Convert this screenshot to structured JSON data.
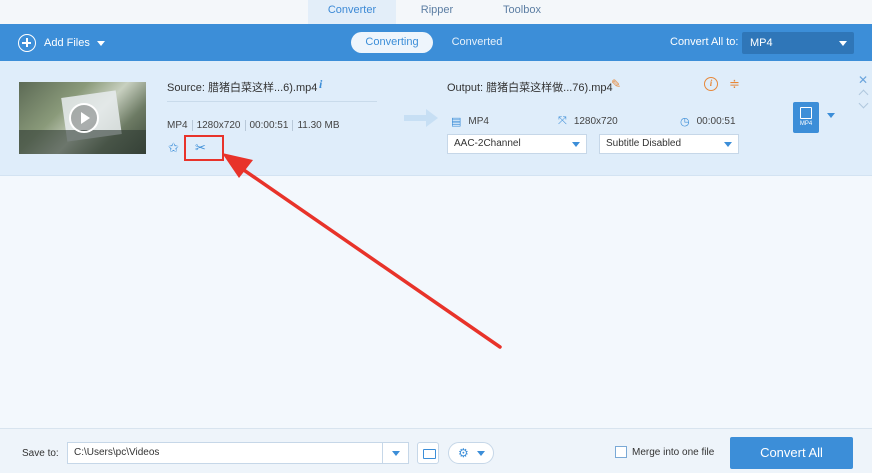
{
  "tabs": {
    "converter": "Converter",
    "ripper": "Ripper",
    "toolbox": "Toolbox",
    "active": "converter"
  },
  "toolbar": {
    "add_files": "Add Files",
    "converting": "Converting",
    "converted": "Converted",
    "convert_all_to": "Convert All to:",
    "format": "MP4"
  },
  "file": {
    "source_name": "Source: 腊猪白菜这样...6).mp4",
    "format": "MP4",
    "resolution": "1280x720",
    "duration": "00:00:51",
    "size": "11.30 MB",
    "output_name": "Output: 腊猪白菜这样做...76).mp4",
    "output_format": "MP4",
    "output_resolution": "1280x720",
    "output_duration": "00:00:51",
    "audio_track": "AAC-2Channel",
    "subtitle": "Subtitle Disabled",
    "format_badge": "MP4"
  },
  "bottom": {
    "save_to": "Save to:",
    "save_path": "C:\\Users\\pc\\Videos",
    "merge_label": "Merge into one file",
    "convert_all": "Convert All"
  },
  "colors": {
    "accent": "#3c8ed8",
    "annotation": "#e8332a"
  }
}
